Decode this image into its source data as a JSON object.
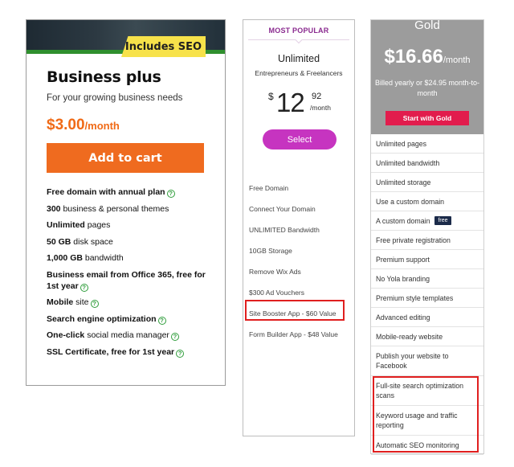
{
  "business_plus": {
    "badge": "Includes SEO",
    "title": "Business plus",
    "subtitle": "For your growing business needs",
    "price": "$3.00",
    "price_period": "/month",
    "cta": "Add to cart",
    "help_glyph": "?",
    "features": [
      {
        "bold": "Free domain with annual plan",
        "rest": "",
        "help": true
      },
      {
        "bold": "300",
        "rest": " business & personal themes",
        "help": false
      },
      {
        "bold": "Unlimited",
        "rest": " pages",
        "help": false
      },
      {
        "bold": "50 GB",
        "rest": " disk space",
        "help": false
      },
      {
        "bold": "1,000 GB",
        "rest": " bandwidth",
        "help": false
      },
      {
        "bold": "Business email from Office 365, free for 1st year",
        "rest": "",
        "help": true
      },
      {
        "bold": "Mobile",
        "rest": " site",
        "help": true
      },
      {
        "bold": "Search engine optimization",
        "rest": "",
        "help": true
      },
      {
        "bold": "One-click",
        "rest": " social media manager",
        "help": true
      },
      {
        "bold": "SSL Certificate, free for 1st year",
        "rest": "",
        "help": true
      }
    ],
    "colors": {
      "accent": "#f06a16",
      "badge": "#f7e24a",
      "stripe": "#2f8f2e"
    }
  },
  "unlimited": {
    "ribbon": "MOST POPULAR",
    "title": "Unlimited",
    "subtitle": "Entrepreneurs & Freelancers",
    "currency": "$",
    "price_whole": "12",
    "price_cents": "92",
    "price_period": "/month",
    "cta": "Select",
    "features": [
      "Free Domain",
      "Connect Your Domain",
      "UNLIMITED Bandwidth",
      "10GB Storage",
      "Remove Wix Ads",
      "$300 Ad Vouchers",
      "Site Booster App - $60 Value",
      "Form Builder App - $48 Value"
    ],
    "colors": {
      "accent": "#c634c0",
      "ribbon": "#8a2a8f"
    }
  },
  "gold": {
    "title": "Gold",
    "price": "$16.66",
    "price_period": "/month",
    "billing_note": "Billed yearly or $24.95 month-to-month",
    "cta": "Start with Gold",
    "features": [
      {
        "text": "Unlimited pages",
        "badge": ""
      },
      {
        "text": "Unlimited bandwidth",
        "badge": ""
      },
      {
        "text": "Unlimited storage",
        "badge": ""
      },
      {
        "text": "Use a custom domain",
        "badge": ""
      },
      {
        "text": "A custom domain",
        "badge": "free"
      },
      {
        "text": "Free private registration",
        "badge": ""
      },
      {
        "text": "Premium support",
        "badge": ""
      },
      {
        "text": "No Yola branding",
        "badge": ""
      },
      {
        "text": "Premium style templates",
        "badge": ""
      },
      {
        "text": "Advanced editing",
        "badge": ""
      },
      {
        "text": "Mobile-ready website",
        "badge": ""
      },
      {
        "text": "Publish your website to Facebook",
        "badge": ""
      },
      {
        "text": "Full-site search optimization scans",
        "badge": ""
      },
      {
        "text": "Keyword usage and traffic reporting",
        "badge": ""
      },
      {
        "text": "Automatic SEO monitoring",
        "badge": ""
      }
    ],
    "colors": {
      "header": "#9c9c9c",
      "button": "#e21c4d",
      "badge": "#1c2b4a"
    }
  },
  "highlight_color": "#e01f1f"
}
